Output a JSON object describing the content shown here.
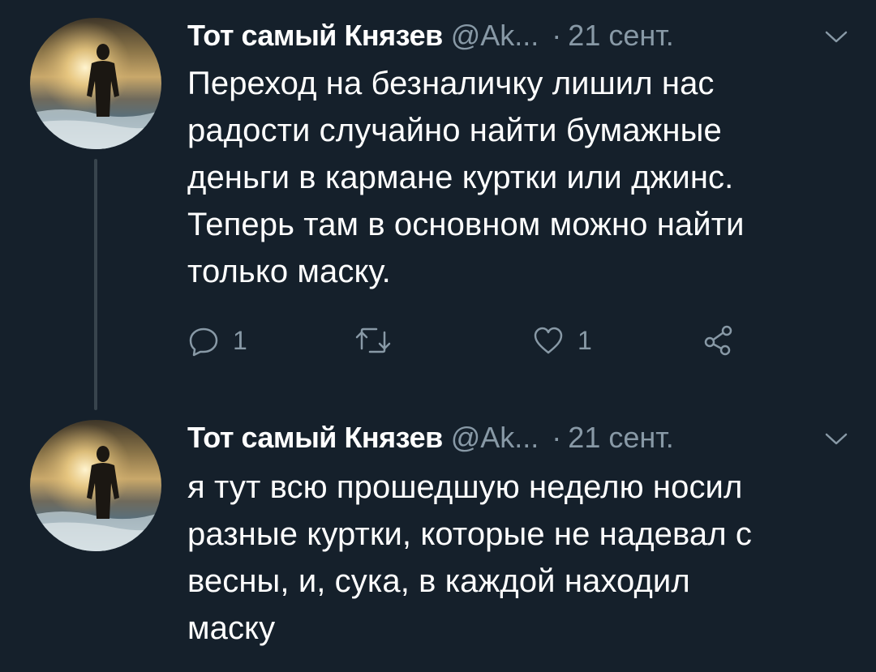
{
  "colors": {
    "background": "#15202b",
    "primary_text": "#ffffff",
    "secondary_text": "#8899a6",
    "thread_line": "#38444d"
  },
  "tweets": [
    {
      "avatar_icon": "avatar-silhouette-sunset",
      "name": "Тот самый Князев",
      "handle": "@Ak...",
      "dot": "·",
      "time": "21 сент.",
      "menu_icon": "chevron-down-icon",
      "text": "Переход на безналичку лишил нас\nрадости случайно найти бумажные\nденьги в кармане куртки или джинс.\nТеперь там в основном можно найти\nтолько маску.",
      "actions": {
        "reply_icon": "reply-icon",
        "reply_count": "1",
        "retweet_icon": "retweet-icon",
        "like_icon": "heart-icon",
        "like_count": "1",
        "share_icon": "share-icon"
      }
    },
    {
      "avatar_icon": "avatar-silhouette-sunset",
      "name": "Тот самый Князев",
      "handle": "@Ak...",
      "dot": "·",
      "time": "21 сент.",
      "menu_icon": "chevron-down-icon",
      "text": "я тут всю прошедшую неделю носил\nразные куртки, которые не надевал с\nвесны, и, сука, в каждой находил\nмаску"
    }
  ]
}
